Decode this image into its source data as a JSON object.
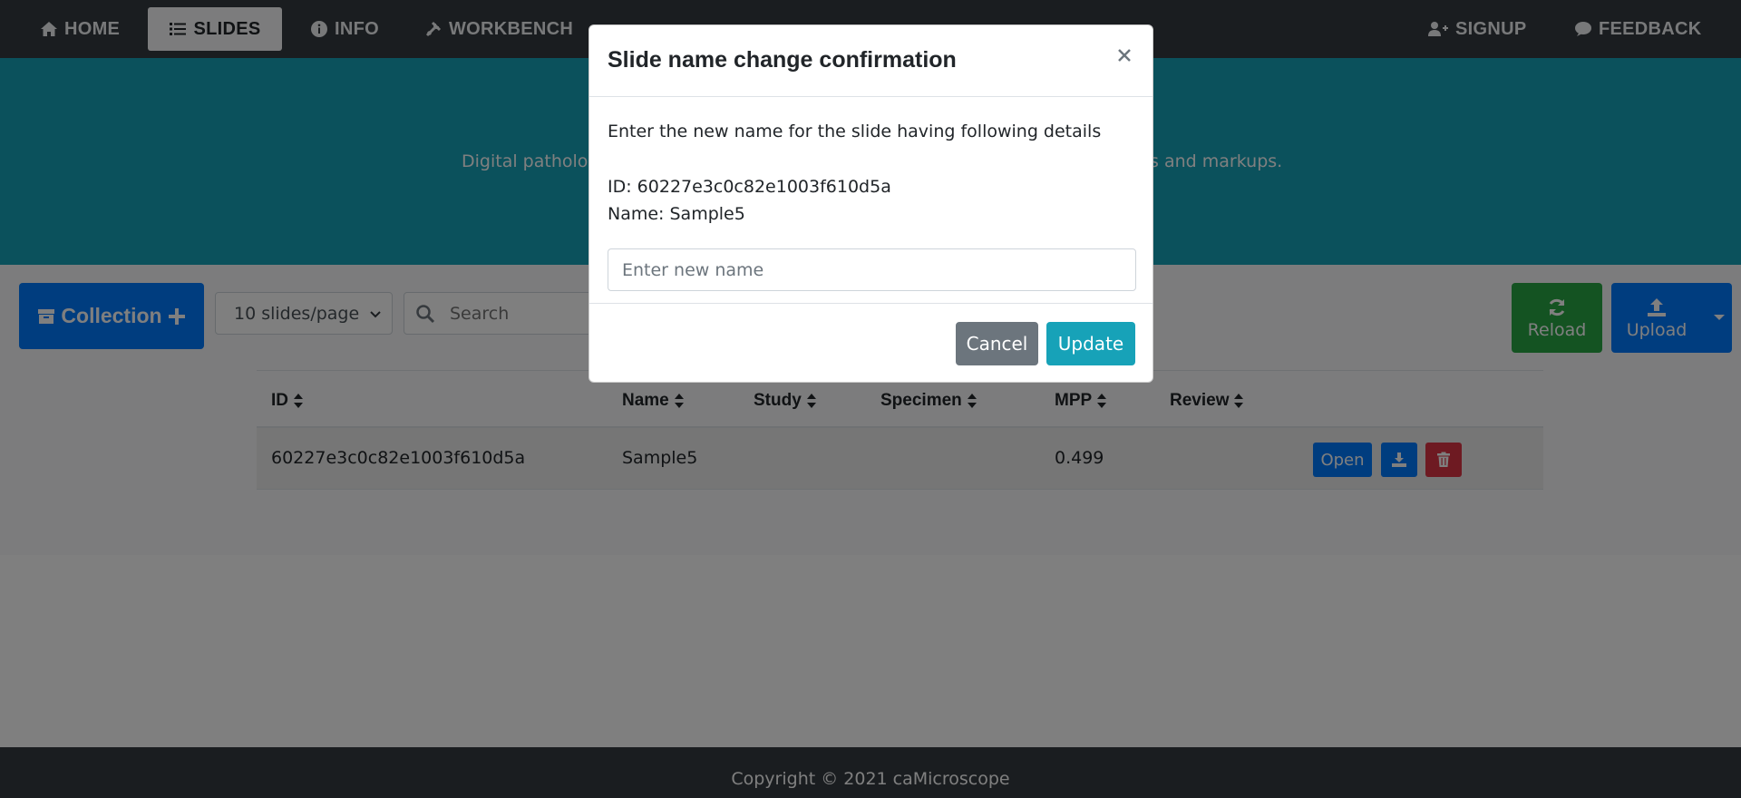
{
  "navbar": {
    "left_items": [
      {
        "label": "HOME",
        "icon": "home-icon"
      },
      {
        "label": "SLIDES",
        "icon": "list-icon",
        "active": true
      },
      {
        "label": "INFO",
        "icon": "info-circle-icon"
      },
      {
        "label": "WORKBENCH",
        "icon": "tools-icon"
      }
    ],
    "right_items": [
      {
        "label": "SIGNUP",
        "icon": "user-plus-icon"
      },
      {
        "label": "FEEDBACK",
        "icon": "comment-icon"
      }
    ]
  },
  "jumbotron": {
    "description_visible_left": "Digital patholog",
    "description_visible_right": "ns and markups."
  },
  "toolbar": {
    "collection_label": "Collection",
    "per_page_selected": "10 slides/page",
    "search_placeholder": "Search",
    "reload_label": "Reload",
    "upload_label": "Upload"
  },
  "table": {
    "columns": [
      "ID",
      "Name",
      "Study",
      "Specimen",
      "MPP",
      "Review"
    ],
    "rows": [
      {
        "id": "60227e3c0c82e1003f610d5a",
        "name": "Sample5",
        "study": "",
        "specimen": "",
        "mpp": "0.499",
        "review": "",
        "open_label": "Open"
      }
    ]
  },
  "footer": {
    "text": "Copyright © 2021 caMicroscope"
  },
  "modal": {
    "title": "Slide name change confirmation",
    "close_glyph": "×",
    "intro": "Enter the new name for the slide having following details",
    "id_line": "ID: 60227e3c0c82e1003f610d5a",
    "name_line": "Name: Sample5",
    "input_placeholder": "Enter new name",
    "cancel_label": "Cancel",
    "update_label": "Update"
  },
  "colors": {
    "navbar": "#343a40",
    "jumbotron": "#17a2b8",
    "primary": "#007bff",
    "success": "#28a745",
    "danger": "#dc3545",
    "secondary": "#6c757d",
    "info": "#17a2b8"
  }
}
